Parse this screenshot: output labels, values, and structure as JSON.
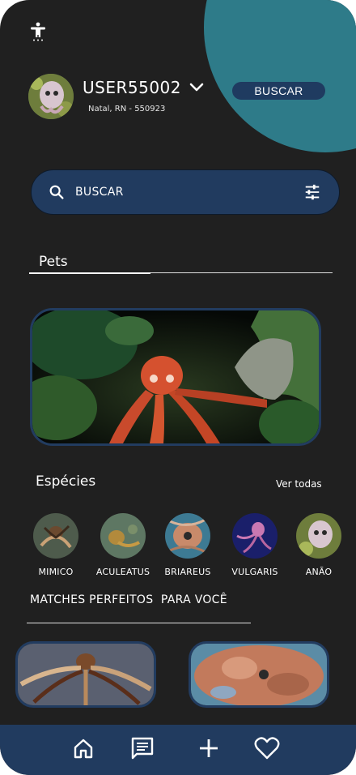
{
  "header": {
    "username": "USER55002",
    "location": "Natal, RN - 550923",
    "buscar_button": "BUSCAR"
  },
  "search": {
    "placeholder": "BUSCAR"
  },
  "pets_section": {
    "title": "Pets"
  },
  "species_section": {
    "title": "Espécies",
    "see_all": "Ver todas",
    "items": [
      {
        "label": "MIMICO"
      },
      {
        "label": "ACULEATUS"
      },
      {
        "label": "BRIAREUS"
      },
      {
        "label": "VULGARIS"
      },
      {
        "label": "ANÃO"
      }
    ]
  },
  "matches_section": {
    "title": "MATCHES PERFEITOS  PARA VOCÊ"
  },
  "bottom_nav": {
    "items": [
      "home-icon",
      "chat-icon",
      "plus-icon",
      "heart-icon"
    ]
  },
  "colors": {
    "background": "#202020",
    "accent_teal": "#2e7b89",
    "navy": "#213b5f"
  }
}
